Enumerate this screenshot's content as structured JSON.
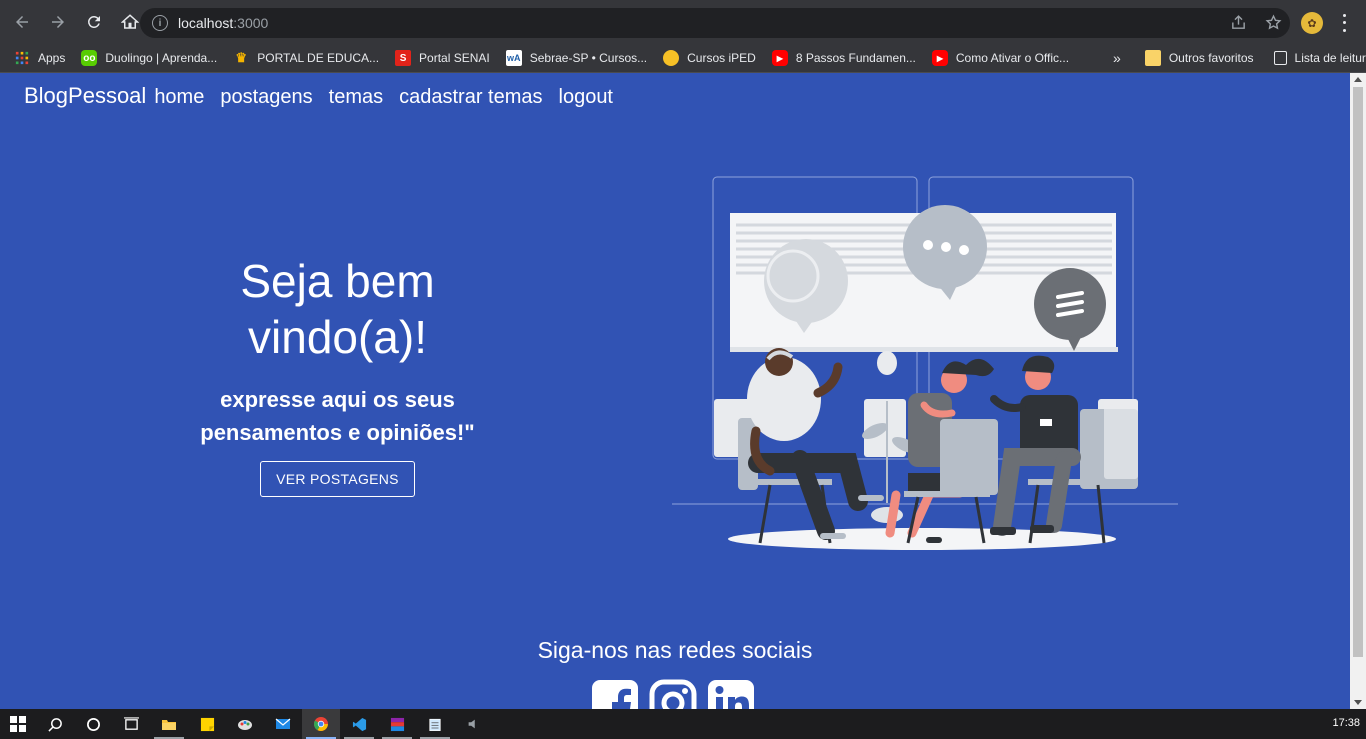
{
  "browser": {
    "url_host": "localhost",
    "url_port": ":3000",
    "bookmarks": [
      {
        "label": "Apps",
        "icon": "apps-grid-icon",
        "color": "#ea4335"
      },
      {
        "label": "Duolingo | Aprenda...",
        "icon": "duolingo-icon",
        "color": "#58cc02"
      },
      {
        "label": "PORTAL DE EDUCA...",
        "icon": "crown-icon",
        "color": "#f4b400"
      },
      {
        "label": "Portal SENAI",
        "icon": "senai-icon",
        "color": "#e2231a"
      },
      {
        "label": "Sebrae-SP • Cursos...",
        "icon": "sebrae-icon",
        "color": "#1f5fa8"
      },
      {
        "label": "Cursos iPED",
        "icon": "iped-icon",
        "color": "#f6c026"
      },
      {
        "label": "8 Passos Fundamen...",
        "icon": "youtube-icon",
        "color": "#ff0000"
      },
      {
        "label": "Como Ativar o Offic...",
        "icon": "youtube-icon",
        "color": "#ff0000"
      }
    ],
    "more_label": "»",
    "other_favorites": "Outros favoritos",
    "reading_list": "Lista de leitura"
  },
  "navbar": {
    "brand": "BlogPessoal",
    "links": [
      "home",
      "postagens",
      "temas",
      "cadastrar temas",
      "logout"
    ]
  },
  "hero": {
    "title": "Seja bem vindo(a)!",
    "subtitle": "expresse aqui os seus pensamentos e opiniões!\"",
    "button": "VER POSTAGENS"
  },
  "social": {
    "title": "Siga-nos nas redes sociais",
    "icons": [
      "facebook-icon",
      "instagram-icon",
      "linkedin-icon"
    ]
  },
  "taskbar": {
    "time": "17:38"
  },
  "colors": {
    "page_bg": "#3153b4",
    "chrome_bg": "#35363a"
  }
}
